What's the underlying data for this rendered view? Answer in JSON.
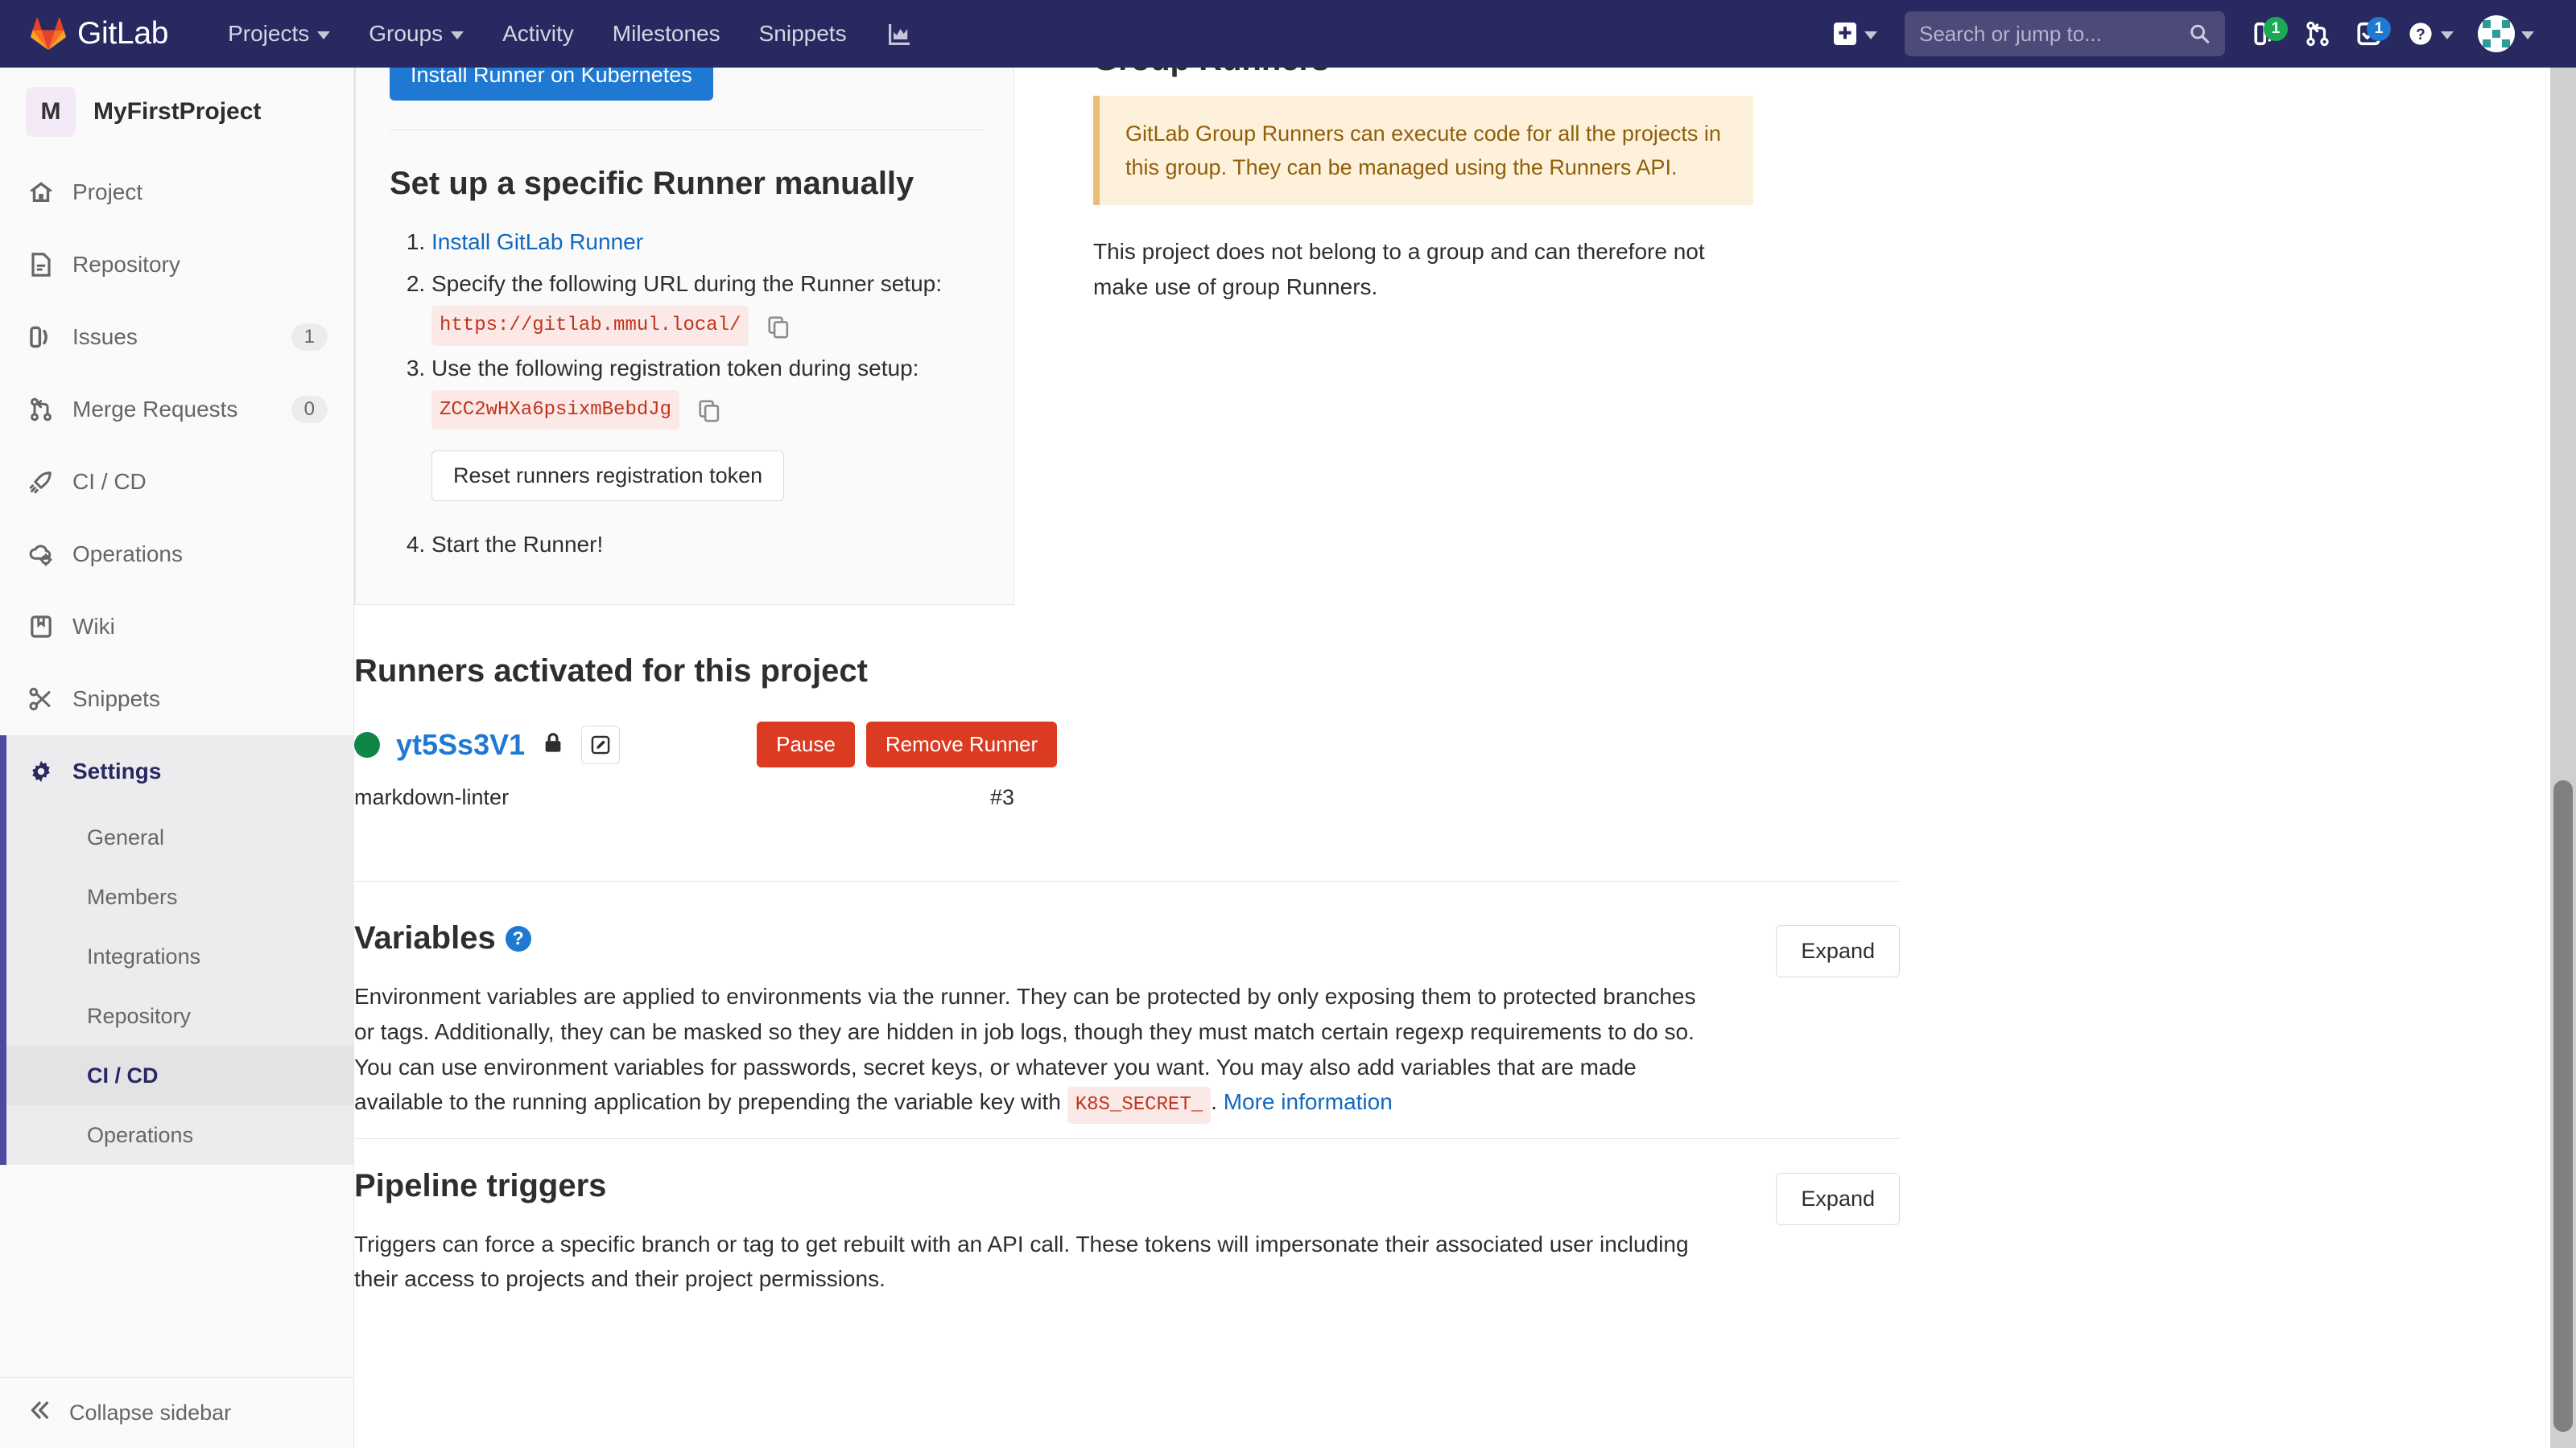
{
  "navbar": {
    "brand": "GitLab",
    "links": [
      {
        "label": "Projects",
        "has_caret": true
      },
      {
        "label": "Groups",
        "has_caret": true
      },
      {
        "label": "Activity",
        "has_caret": false
      },
      {
        "label": "Milestones",
        "has_caret": false
      },
      {
        "label": "Snippets",
        "has_caret": false
      }
    ],
    "analytics_icon": "chart-icon",
    "plus_icon": "plus-square-icon",
    "search": {
      "placeholder": "Search or jump to...",
      "value": "",
      "icon": "search-icon"
    },
    "issues": {
      "icon": "issues-icon",
      "count": "1"
    },
    "merge_requests": {
      "icon": "merge-request-icon",
      "count": ""
    },
    "todos": {
      "icon": "todo-check-icon",
      "count": "1"
    },
    "help": {
      "icon": "question-circle-icon"
    },
    "avatar": {
      "icon": "user-avatar-identicon"
    }
  },
  "sidebar": {
    "project": {
      "initial": "M",
      "name": "MyFirstProject"
    },
    "items": [
      {
        "label": "Project",
        "icon": "home-icon",
        "badge": "",
        "active": false
      },
      {
        "label": "Repository",
        "icon": "document-icon",
        "badge": "",
        "active": false
      },
      {
        "label": "Issues",
        "icon": "issues-icon",
        "badge": "1",
        "active": false
      },
      {
        "label": "Merge Requests",
        "icon": "merge-request-icon",
        "badge": "0",
        "active": false
      },
      {
        "label": "CI / CD",
        "icon": "rocket-icon",
        "badge": "",
        "active": false
      },
      {
        "label": "Operations",
        "icon": "cloud-gear-icon",
        "badge": "",
        "active": false
      },
      {
        "label": "Wiki",
        "icon": "book-icon",
        "badge": "",
        "active": false
      },
      {
        "label": "Snippets",
        "icon": "scissors-icon",
        "badge": "",
        "active": false
      },
      {
        "label": "Settings",
        "icon": "gear-icon",
        "badge": "",
        "active": true
      }
    ],
    "settings_subitems": [
      {
        "label": "General",
        "active": false
      },
      {
        "label": "Members",
        "active": false
      },
      {
        "label": "Integrations",
        "active": false
      },
      {
        "label": "Repository",
        "active": false
      },
      {
        "label": "CI / CD",
        "active": true
      },
      {
        "label": "Operations",
        "active": false
      }
    ],
    "collapse": {
      "label": "Collapse sidebar",
      "icon": "chevron-double-left-icon"
    }
  },
  "runner_setup": {
    "install_kubernetes_button": "Install Runner on Kubernetes",
    "heading": "Set up a specific Runner manually",
    "steps": {
      "step1_link": "Install GitLab Runner",
      "step2_text": "Specify the following URL during the Runner setup:",
      "step2_code": "https://gitlab.mmul.local/",
      "step3_text": "Use the following registration token during setup:",
      "step3_code": "ZCC2wHXa6psixmBebdJg",
      "reset_button": "Reset runners registration token",
      "step4_text": "Start the Runner!"
    },
    "copy_icon": "copy-icon"
  },
  "group_runners": {
    "heading": "Group Runners",
    "alert": "GitLab Group Runners can execute code for all the projects in this group. They can be managed using the Runners API.",
    "body": "This project does not belong to a group and can therefore not make use of group Runners."
  },
  "activated_runners": {
    "heading": "Runners activated for this project",
    "runner": {
      "status_icon": "status-online-dot",
      "name": "yt5Ss3V1",
      "lock_icon": "lock-icon",
      "edit_icon": "pencil-edit-icon",
      "pause_button": "Pause",
      "remove_button": "Remove Runner",
      "tag": "markdown-linter",
      "id": "#3"
    }
  },
  "variables_section": {
    "title": "Variables",
    "help_icon": "question-circle-icon",
    "expand_button": "Expand",
    "description_part1": "Environment variables are applied to environments via the runner. They can be protected by only exposing them to protected branches or tags. Additionally, they can be masked so they are hidden in job logs, though they must match certain regexp requirements to do so. You can use environment variables for passwords, secret keys, or whatever you want. You may also add variables that are made available to the running application by prepending the variable key with",
    "code": "K8S_SECRET_",
    "description_part2": ".",
    "more_info_link": "More information"
  },
  "pipeline_triggers_section": {
    "title": "Pipeline triggers",
    "expand_button": "Expand",
    "description": "Triggers can force a specific branch or tag to get rebuilt with an API call. These tokens will impersonate their associated user including their access to projects and their project permissions."
  },
  "colors": {
    "navbar_bg": "#292961",
    "accent_blue": "#1f78d1",
    "danger_red": "#db3b21",
    "success_green": "#108548",
    "warning_bg": "#fdf1dc",
    "active_indigo": "#4b4ba3"
  }
}
